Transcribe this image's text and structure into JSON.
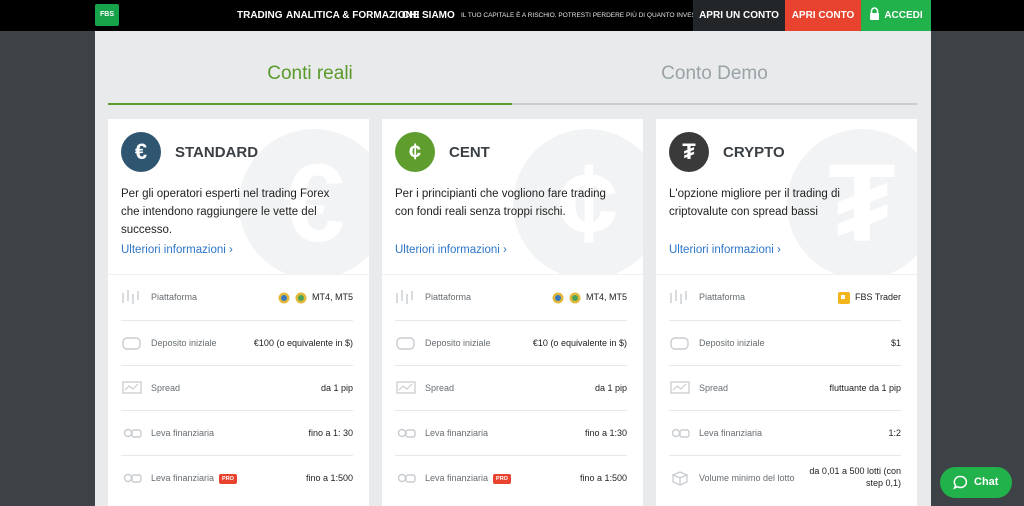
{
  "brand": {
    "logo_text": "FBS"
  },
  "nav": {
    "links": [
      "TRADING",
      "ANALITICA & FORMAZIONE",
      "CHI SIAMO"
    ],
    "risk_notice": "IL TUO CAPITALE È A RISCHIO. POTRESTI PERDERE PIÙ DI QUANTO INVESTI.",
    "open_account": "APRI UN CONTO",
    "open_account_cta": "APRI CONTO",
    "login": "ACCEDI"
  },
  "tabs": {
    "real": "Conti reali",
    "demo": "Conto Demo"
  },
  "colors": {
    "accent_green": "#5a9a2a",
    "brand_green": "#22b24c",
    "cta_red": "#e7432f",
    "link_blue": "#2d76c8"
  },
  "cards": [
    {
      "title": "STANDARD",
      "coin_symbol": "€",
      "coin_color": "#2f5670",
      "description": "Per gli operatori esperti nel trading Forex che intendono raggiungere le vette del successo.",
      "more": "Ulteriori informazioni",
      "rows": [
        {
          "icon": "platform-icon",
          "label": "Piattaforma",
          "value": "MT4, MT5",
          "platform": true
        },
        {
          "icon": "deposit-icon",
          "label": "Deposito iniziale",
          "value": "€100 (o equivalente in $)"
        },
        {
          "icon": "spread-icon",
          "label": "Spread",
          "value": "da 1 pip"
        },
        {
          "icon": "leverage-icon",
          "label": "Leva finanziaria",
          "value": "fino a 1: 30"
        },
        {
          "icon": "leverage-icon",
          "label": "Leva finanziaria",
          "value": "fino a 1:500",
          "pro": "PRO"
        }
      ]
    },
    {
      "title": "CENT",
      "coin_symbol": "¢",
      "coin_color": "#5e9d2e",
      "description": "Per i principianti che vogliono fare trading con fondi reali senza troppi rischi.",
      "more": "Ulteriori informazioni",
      "rows": [
        {
          "icon": "platform-icon",
          "label": "Piattaforma",
          "value": "MT4, MT5",
          "platform": true
        },
        {
          "icon": "deposit-icon",
          "label": "Deposito iniziale",
          "value": "€10 (o equivalente in $)"
        },
        {
          "icon": "spread-icon",
          "label": "Spread",
          "value": "da 1 pip"
        },
        {
          "icon": "leverage-icon",
          "label": "Leva finanziaria",
          "value": "fino a 1:30"
        },
        {
          "icon": "leverage-icon",
          "label": "Leva finanziaria",
          "value": "fino a 1:500",
          "pro": "PRO"
        }
      ]
    },
    {
      "title": "CRYPTO",
      "coin_symbol": "₮",
      "coin_color": "#3a3a3a",
      "description": "L'opzione migliore per il trading di criptovalute con spread bassi",
      "more": "Ulteriori informazioni",
      "rows": [
        {
          "icon": "platform-icon",
          "label": "Piattaforma",
          "value": "FBS Trader",
          "fbs": true
        },
        {
          "icon": "deposit-icon",
          "label": "Deposito iniziale",
          "value": "$1"
        },
        {
          "icon": "spread-icon",
          "label": "Spread",
          "value": "fluttuante da 1 pip"
        },
        {
          "icon": "leverage-icon",
          "label": "Leva finanziaria",
          "value": "1:2"
        },
        {
          "icon": "lot-icon",
          "label": "Volume minimo del lotto",
          "value": "da 0,01 a 500 lotti (con step 0,1)",
          "multi": true
        }
      ]
    }
  ],
  "chat": {
    "label": "Chat"
  }
}
